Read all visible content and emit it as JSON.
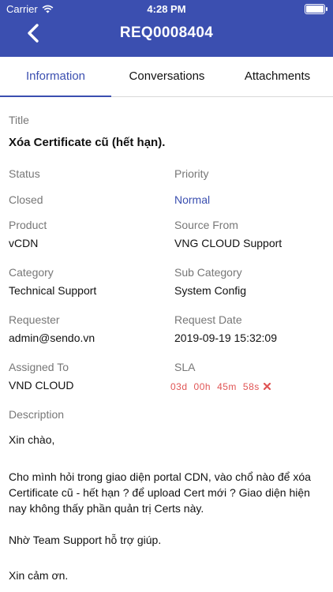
{
  "status_bar": {
    "carrier": "Carrier",
    "time": "4:28 PM"
  },
  "header": {
    "title": "REQ0008404"
  },
  "tabs": [
    {
      "label": "Information",
      "active": true
    },
    {
      "label": "Conversations",
      "active": false
    },
    {
      "label": "Attachments",
      "active": false
    }
  ],
  "info": {
    "title_label": "Title",
    "title_value": "Xóa Certificate cũ (hết hạn).",
    "status_label": "Status",
    "status_value": "Closed",
    "priority_label": "Priority",
    "priority_value": "Normal",
    "product_label": "Product",
    "product_value": "vCDN",
    "source_label": "Source From",
    "source_value": "VNG CLOUD Support",
    "category_label": "Category",
    "category_value": "Technical Support",
    "subcategory_label": "Sub Category",
    "subcategory_value": "System Config",
    "requester_label": "Requester",
    "requester_value": "admin@sendo.vn",
    "request_date_label": "Request Date",
    "request_date_value": "2019-09-19 15:32:09",
    "assigned_label": "Assigned To",
    "assigned_value": "VND CLOUD",
    "sla_label": "SLA",
    "sla_days": "03d",
    "sla_hours": "00h",
    "sla_minutes": "45m",
    "sla_seconds": "58s",
    "description_label": "Description",
    "description_lines": [
      "Xin chào,",
      "Cho mình hỏi trong giao diện portal CDN, vào chổ nào để xóa Certificate cũ - hết hạn ? để upload Cert mới ? Giao diện hiện nay không thấy phần quản trị Certs này.",
      "Nhờ Team Support hỗ trợ giúp.",
      "Xin cảm ơn."
    ]
  },
  "colors": {
    "primary": "#3b4fb0",
    "sla": "#e05555",
    "label": "#777777"
  }
}
